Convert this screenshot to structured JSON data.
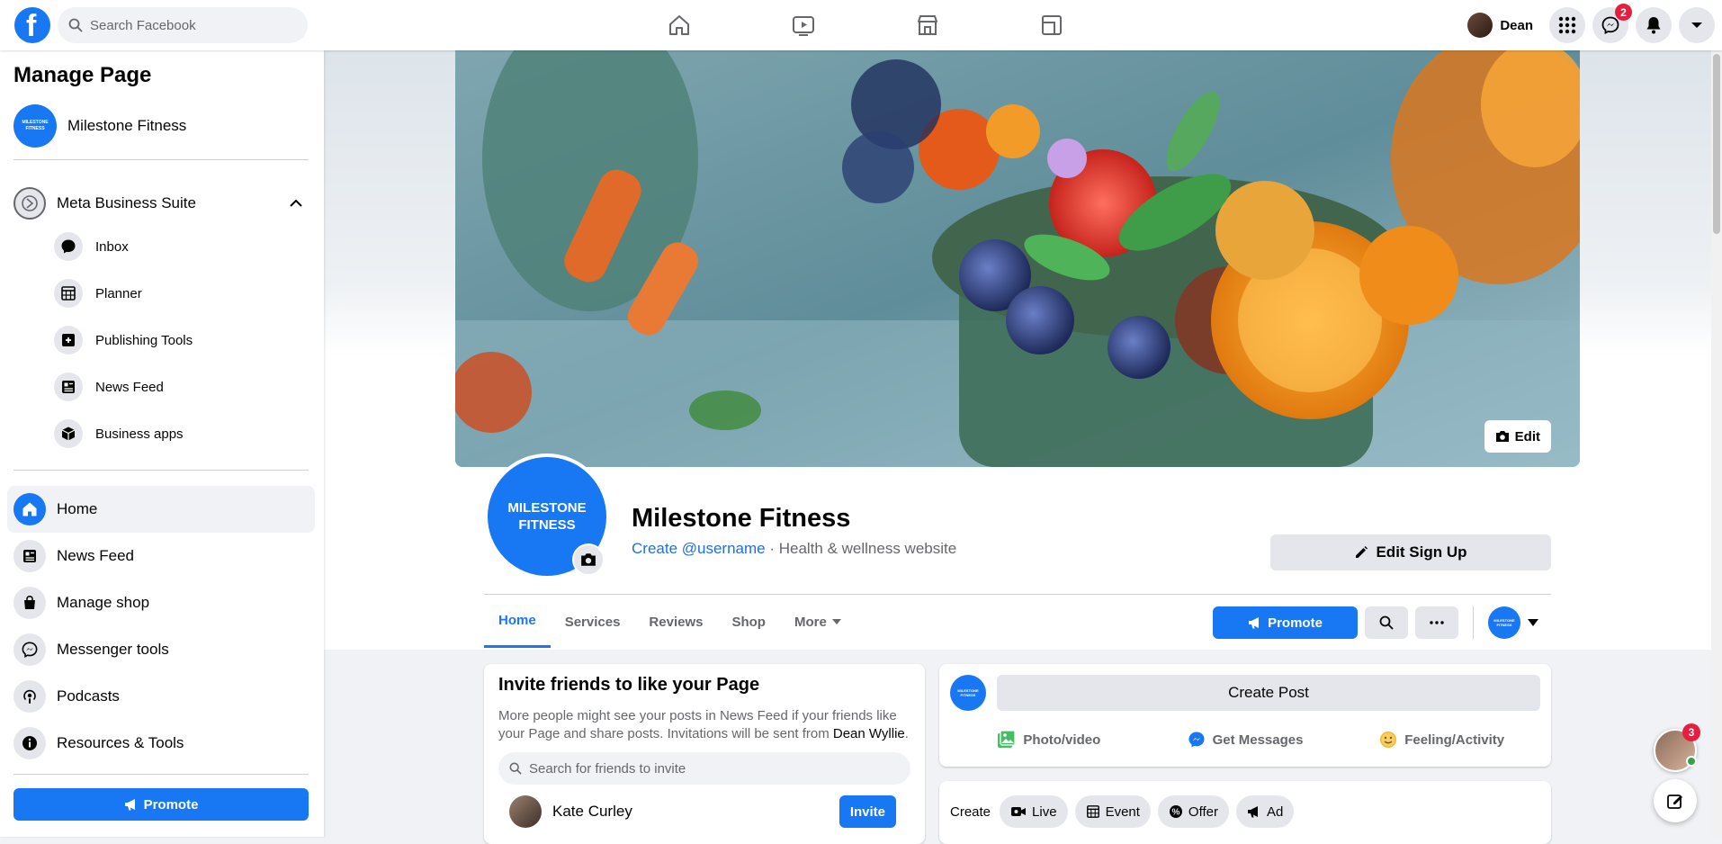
{
  "topbar": {
    "search_placeholder": "Search Facebook",
    "profile_name": "Dean",
    "messenger_badge": "2",
    "nav_icons": [
      "home-icon",
      "watch-icon",
      "marketplace-icon",
      "gaming-icon"
    ]
  },
  "sidebar": {
    "title": "Manage Page",
    "page_name": "Milestone Fitness",
    "page_avatar_text": "MILESTONE FITNESS",
    "business_suite": "Meta Business Suite",
    "suite_items": [
      {
        "label": "Inbox",
        "icon": "chat-bubble-icon"
      },
      {
        "label": "Planner",
        "icon": "calendar-icon"
      },
      {
        "label": "Publishing Tools",
        "icon": "publishing-tools-icon"
      },
      {
        "label": "News Feed",
        "icon": "news-feed-icon"
      },
      {
        "label": "Business apps",
        "icon": "cube-icon"
      }
    ],
    "nav_items": [
      {
        "label": "Home",
        "icon": "home-icon"
      },
      {
        "label": "News Feed",
        "icon": "news-feed-icon"
      },
      {
        "label": "Manage shop",
        "icon": "shopping-bag-icon"
      },
      {
        "label": "Messenger tools",
        "icon": "messenger-icon"
      },
      {
        "label": "Podcasts",
        "icon": "podcast-icon"
      },
      {
        "label": "Resources & Tools",
        "icon": "info-icon"
      }
    ],
    "promote_label": "Promote"
  },
  "page": {
    "cover_edit_label": "Edit",
    "avatar_text": "MILESTONE FITNESS",
    "name": "Milestone Fitness",
    "username_link": "Create @username",
    "category": " · Health & wellness website",
    "cta_label": "Edit Sign Up",
    "tabs": [
      "Home",
      "Services",
      "Reviews",
      "Shop",
      "More"
    ],
    "promote_label": "Promote"
  },
  "invite": {
    "title": "Invite friends to like your Page",
    "desc_prefix": "More people might see your posts in News Feed if your friends like your Page and share posts. Invitations will be sent from ",
    "desc_name": "Dean Wyllie",
    "desc_suffix": ".",
    "search_placeholder": "Search for friends to invite",
    "friend_name": "Kate Curley",
    "invite_label": "Invite"
  },
  "composer": {
    "create_post": "Create Post",
    "actions": [
      "Photo/video",
      "Get Messages",
      "Feeling/Activity"
    ]
  },
  "create_bar": {
    "label": "Create",
    "chips": [
      "Live",
      "Event",
      "Offer",
      "Ad"
    ]
  },
  "chat": {
    "badge": "3"
  },
  "colors": {
    "accent": "#1877f2",
    "badge": "#e41e3f",
    "online": "#31a24c"
  }
}
